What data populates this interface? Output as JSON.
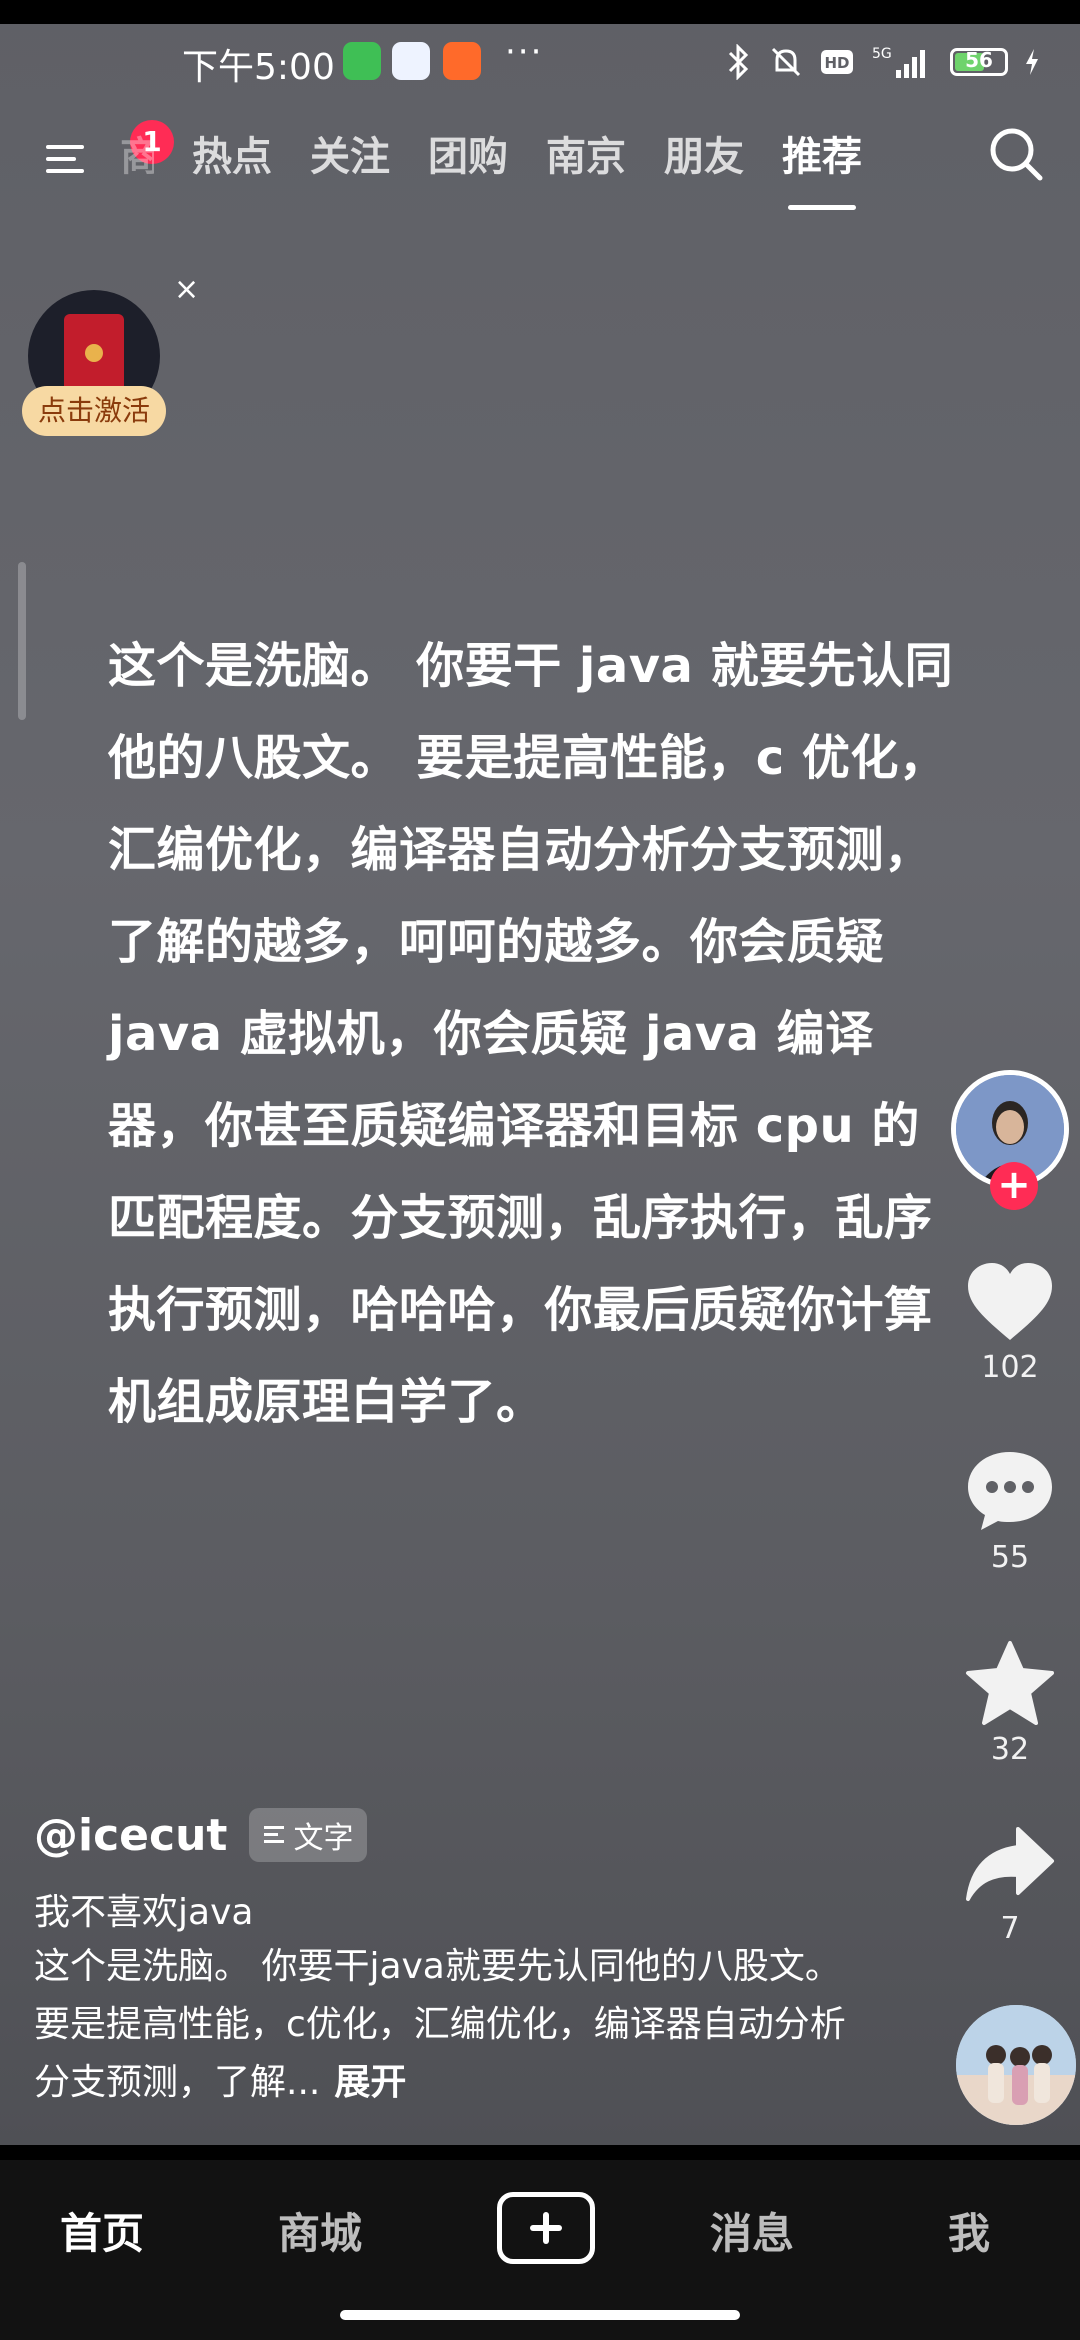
{
  "status_bar": {
    "time": "下午5:00",
    "more": "···",
    "battery": "56",
    "network": "5G"
  },
  "top_nav": {
    "badge": "1",
    "tabs": [
      "热点",
      "关注",
      "团购",
      "南京",
      "朋友",
      "推荐"
    ],
    "partial_tab": "商",
    "active_tab": "推荐"
  },
  "red_packet": {
    "label": "点击激活",
    "close": "×"
  },
  "main_text": "这个是洗脑。 你要干 java 就要先认同他的八股文。 要是提高性能，c 优化，汇编优化，编译器自动分析分支预测，了解的越多，呵呵的越多。你会质疑 java 虚拟机，你会质疑 java 编译器，你甚至质疑编译器和目标 cpu 的匹配程度。分支预测，乱序执行，乱序执行预测，哈哈哈，你最后质疑你计算机组成原理白学了。",
  "actions": {
    "follow": "+",
    "likes": "102",
    "comments": "55",
    "favorites": "32",
    "shares": "7"
  },
  "caption": {
    "author": "@icecut",
    "tag": "文字",
    "title": "我不喜欢java",
    "body": "这个是洗脑。 你要干java就要先认同他的八股文。 要是提高性能，c优化，汇编优化，编译器自动分析分支预测，了解...",
    "expand": "展开"
  },
  "bottom_nav": {
    "home": "首页",
    "mall": "商城",
    "messages": "消息",
    "me": "我"
  }
}
